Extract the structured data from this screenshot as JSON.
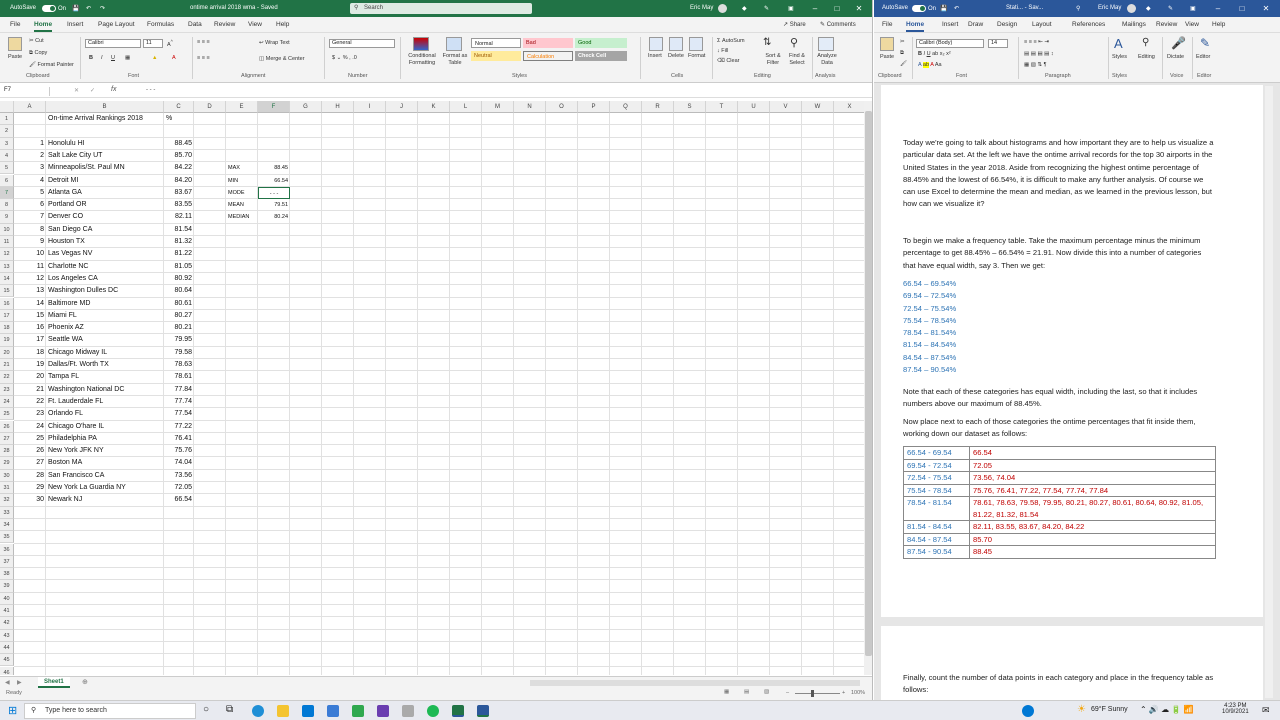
{
  "excel": {
    "autosave_label": "AutoSave",
    "autosave_state": "On",
    "file_title": "ontime arrival 2018 wma - Saved",
    "search_placeholder": "Search",
    "user_name": "Eric May",
    "share_label": "Share",
    "comments_label": "Comments",
    "tabs": [
      "File",
      "Home",
      "Insert",
      "Page Layout",
      "Formulas",
      "Data",
      "Review",
      "View",
      "Help"
    ],
    "active_tab": "Home",
    "ribbon": {
      "paste": "Paste",
      "cut": "Cut",
      "copy": "Copy",
      "format_painter": "Format Painter",
      "clipboard": "Clipboard",
      "font_name": "Calibri",
      "font_size": "11",
      "font_group": "Font",
      "wrap_text": "Wrap Text",
      "merge_center": "Merge & Center",
      "alignment_group": "Alignment",
      "number_format": "General",
      "number_group": "Number",
      "conditional_formatting": "Conditional Formatting",
      "format_as_table": "Format as Table",
      "styles": {
        "normal": "Normal",
        "bad": "Bad",
        "good": "Good",
        "neutral": "Neutral",
        "calculation": "Calculation",
        "check_cell": "Check Cell"
      },
      "styles_group": "Styles",
      "insert": "Insert",
      "delete": "Delete",
      "format": "Format",
      "cells_group": "Cells",
      "autosum": "AutoSum",
      "fill": "Fill",
      "clear": "Clear",
      "sort_filter": "Sort & Filter",
      "find_select": "Find & Select",
      "editing_group": "Editing",
      "analyze_data": "Analyze Data",
      "analysis_group": "Analysis"
    },
    "name_box": "F7",
    "formula_value": "- - -",
    "columns": [
      "A",
      "B",
      "C",
      "D",
      "E",
      "F",
      "G",
      "H",
      "I",
      "J",
      "K",
      "L",
      "M",
      "N",
      "O",
      "P",
      "Q",
      "R",
      "S",
      "T",
      "U",
      "V",
      "W",
      "X"
    ],
    "header_title": "On-time Arrival Rankings 2018",
    "header_pct": "%",
    "rankings": [
      {
        "rank": "1",
        "airport": "Honolulu HI",
        "pct": "88.45"
      },
      {
        "rank": "2",
        "airport": "Salt Lake City UT",
        "pct": "85.70"
      },
      {
        "rank": "3",
        "airport": "Minneapolis/St. Paul MN",
        "pct": "84.22"
      },
      {
        "rank": "4",
        "airport": "Detroit MI",
        "pct": "84.20"
      },
      {
        "rank": "5",
        "airport": "Atlanta GA",
        "pct": "83.67"
      },
      {
        "rank": "6",
        "airport": "Portland OR",
        "pct": "83.55"
      },
      {
        "rank": "7",
        "airport": "Denver CO",
        "pct": "82.11"
      },
      {
        "rank": "8",
        "airport": "San Diego CA",
        "pct": "81.54"
      },
      {
        "rank": "9",
        "airport": "Houston TX",
        "pct": "81.32"
      },
      {
        "rank": "10",
        "airport": "Las Vegas NV",
        "pct": "81.22"
      },
      {
        "rank": "11",
        "airport": "Charlotte NC",
        "pct": "81.05"
      },
      {
        "rank": "12",
        "airport": "Los Angeles CA",
        "pct": "80.92"
      },
      {
        "rank": "13",
        "airport": "Washington Dulles DC",
        "pct": "80.64"
      },
      {
        "rank": "14",
        "airport": "Baltimore MD",
        "pct": "80.61"
      },
      {
        "rank": "15",
        "airport": "Miami FL",
        "pct": "80.27"
      },
      {
        "rank": "16",
        "airport": "Phoenix AZ",
        "pct": "80.21"
      },
      {
        "rank": "17",
        "airport": "Seattle WA",
        "pct": "79.95"
      },
      {
        "rank": "18",
        "airport": "Chicago Midway IL",
        "pct": "79.58"
      },
      {
        "rank": "19",
        "airport": "Dallas/Ft. Worth TX",
        "pct": "78.63"
      },
      {
        "rank": "20",
        "airport": "Tampa FL",
        "pct": "78.61"
      },
      {
        "rank": "21",
        "airport": "Washington National DC",
        "pct": "77.84"
      },
      {
        "rank": "22",
        "airport": "Ft. Lauderdale FL",
        "pct": "77.74"
      },
      {
        "rank": "23",
        "airport": "Orlando FL",
        "pct": "77.54"
      },
      {
        "rank": "24",
        "airport": "Chicago O'hare IL",
        "pct": "77.22"
      },
      {
        "rank": "25",
        "airport": "Philadelphia PA",
        "pct": "76.41"
      },
      {
        "rank": "26",
        "airport": "New York JFK NY",
        "pct": "75.76"
      },
      {
        "rank": "27",
        "airport": "Boston MA",
        "pct": "74.04"
      },
      {
        "rank": "28",
        "airport": "San Francisco CA",
        "pct": "73.56"
      },
      {
        "rank": "29",
        "airport": "New York La Guardia NY",
        "pct": "72.05"
      },
      {
        "rank": "30",
        "airport": "Newark NJ",
        "pct": "66.54"
      }
    ],
    "stats": [
      {
        "label": "MAX",
        "value": "88.45"
      },
      {
        "label": "MIN",
        "value": "66.54"
      },
      {
        "label": "MODE",
        "value": "- - -"
      },
      {
        "label": "MEAN",
        "value": "79.51"
      },
      {
        "label": "MEDIAN",
        "value": "80.24"
      }
    ],
    "sheet_tab": "Sheet1",
    "status": "Ready",
    "zoom": "100%"
  },
  "word": {
    "autosave_label": "AutoSave",
    "autosave_state": "On",
    "file_title": "Stati... - Sav...",
    "user_name": "Eric May",
    "tabs": [
      "File",
      "Home",
      "Insert",
      "Draw",
      "Design",
      "Layout",
      "References",
      "Mailings",
      "Review",
      "View",
      "Help"
    ],
    "active_tab": "Home",
    "ribbon": {
      "paste": "Paste",
      "clipboard": "Clipboard",
      "font_name": "Calibri (Body)",
      "font_size": "14",
      "font_group": "Font",
      "paragraph_group": "Paragraph",
      "styles": "Styles",
      "styles_group": "Styles",
      "editing": "Editing",
      "dictate": "Dictate",
      "voice_group": "Voice",
      "editor": "Editor",
      "editor_group": "Editor"
    },
    "para1": "Today we're going to talk about histograms and how important they are to help us visualize a particular data set.  At the left we have the ontime arrival records for the top 30 airports in the United States in the year 2018. Aside from recognizing the highest ontime percentage of 88.45% and the lowest of 66.54%, it is difficult to make any further analysis.  Of course we can use Excel to determine the mean and median, as we learned in the previous lesson, but how can we visualize it?",
    "para2": "To begin we make a frequency table.  Take the maximum percentage minus the minimum percentage to get 88.45% – 66.54% = 21.91.  Now divide this into a number of categories that have equal width, say 3.  Then we get:",
    "ranges": [
      "66.54 – 69.54%",
      "69.54 – 72.54%",
      "72.54 – 75.54%",
      "75.54 – 78.54%",
      "78.54 – 81.54%",
      "81.54 – 84.54%",
      "84.54 – 87.54%",
      "87.54 – 90.54%"
    ],
    "para3": "Note that each of these categories has equal width, including the last, so that it includes numbers above our maximum of 88.45%.",
    "para4": "Now place next to each of those categories the ontime percentages that fit inside them, working down our dataset as follows:",
    "freq_table": [
      {
        "range": "66.54 - 69.54",
        "values": "66.54"
      },
      {
        "range": "69.54 - 72.54",
        "values": "72.05"
      },
      {
        "range": "72.54 - 75.54",
        "values": "73.56, 74.04"
      },
      {
        "range": "75.54 - 78.54",
        "values": "75.76, 76.41, 77.22, 77.54, 77.74, 77.84"
      },
      {
        "range": "78.54 - 81.54",
        "values": "78.61, 78.63, 79.58, 79.95, 80.21, 80.27, 80.61, 80.64, 80.92, 81.05, 81.22, 81.32, 81.54"
      },
      {
        "range": "81.54 - 84.54",
        "values": "82.11, 83.55, 83.67, 84.20, 84.22"
      },
      {
        "range": "84.54 - 87.54",
        "values": "85.70"
      },
      {
        "range": "87.54 - 90.54",
        "values": "88.45"
      }
    ],
    "para5": "Finally, count the number of data points in each category and place in the frequency table as follows:"
  },
  "taskbar": {
    "search_placeholder": "Type here to search",
    "weather": "69°F  Sunny",
    "time": "4:23 PM",
    "date": "10/9/2021"
  },
  "colors": {
    "excel_green": "#217346",
    "word_blue": "#2b579a",
    "range_blue": "#2e74b5",
    "value_red": "#c00000"
  }
}
